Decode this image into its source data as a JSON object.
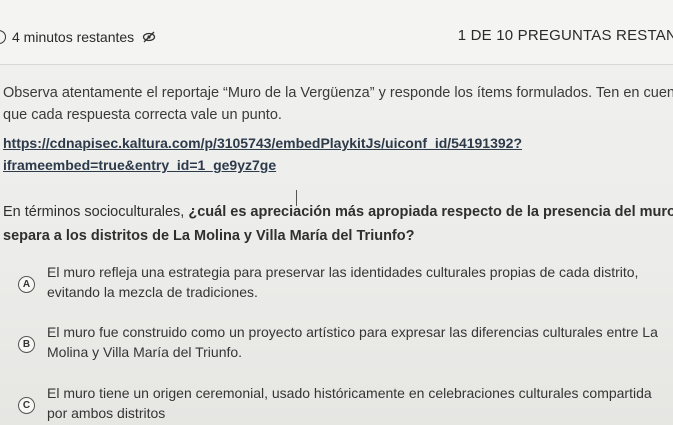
{
  "header": {
    "timer_text": "4 minutos restantes",
    "progress_text": "1 DE 10 PREGUNTAS RESTAN"
  },
  "instructions": {
    "line1": "Observa atentamente el reportaje “Muro de la Vergüenza” y responde los ítems formulados. Ten en cuen",
    "line2": "que cada respuesta correcta vale un punto."
  },
  "video_link": {
    "line1": "https://cdnapisec.kaltura.com/p/3105743/embedPlaykitJs/uiconf_id/54191392?",
    "line2": "iframeembed=true&entry_id=1_ge9yz7ge"
  },
  "question": {
    "intro": "En términos socioculturales, ",
    "bold": "¿cuál es apreciación más apropiada respecto de la presencia del muro q",
    "line2": "separa a los distritos de La Molina y Villa María del Triunfo?"
  },
  "options": [
    {
      "letter": "A",
      "line1": "El muro refleja una estrategia para preservar las identidades culturales propias de cada distrito,",
      "line2": "evitando la mezcla de tradiciones."
    },
    {
      "letter": "B",
      "line1": "El muro fue construido como un proyecto artístico para expresar las diferencias culturales entre La",
      "line2": "Molina y Villa María del Triunfo."
    },
    {
      "letter": "C",
      "line1": "El muro tiene un origen ceremonial, usado históricamente en celebraciones culturales compartida",
      "line2": "por ambos distritos"
    }
  ]
}
